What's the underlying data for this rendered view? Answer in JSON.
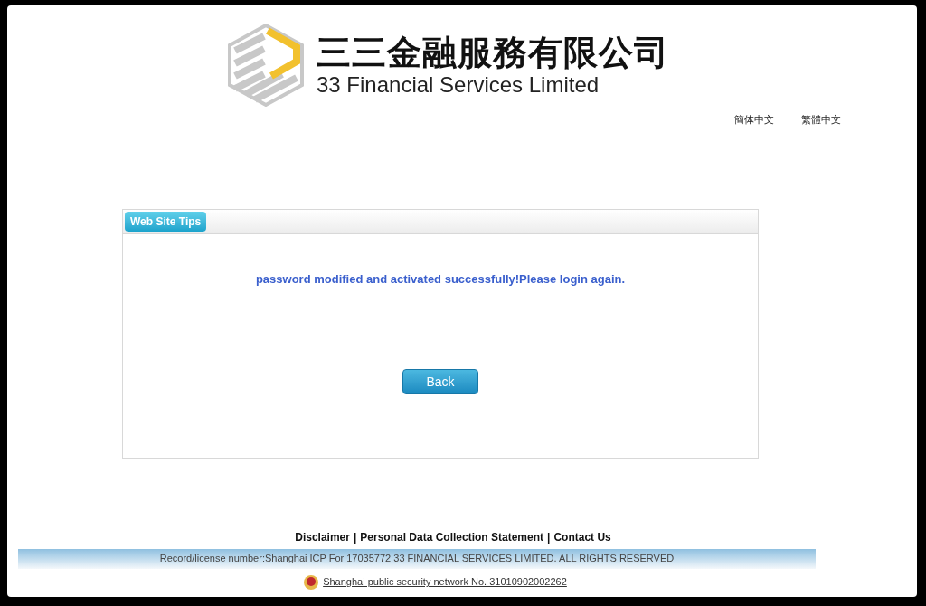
{
  "logo": {
    "name_zh": "三三金融服務有限公司",
    "name_en": "33 Financial Services Limited"
  },
  "languages": [
    {
      "label": "簡体中文"
    },
    {
      "label": "繁體中文"
    }
  ],
  "tips_panel": {
    "tab": "Web Site Tips",
    "message": "password modified and activated successfully!Please login again.",
    "button": "Back"
  },
  "footer": {
    "links": [
      "Disclaimer",
      "Personal Data Collection Statement",
      "Contact Us"
    ],
    "separator": "|",
    "record_prefix": "Record/license number:",
    "record_link": "Shanghai ICP For 17035772",
    "record_suffix": "33 FINANCIAL SERVICES LIMITED. ALL RIGHTS RESERVED",
    "security_link": "Shanghai public security network No. 31010902002262"
  }
}
